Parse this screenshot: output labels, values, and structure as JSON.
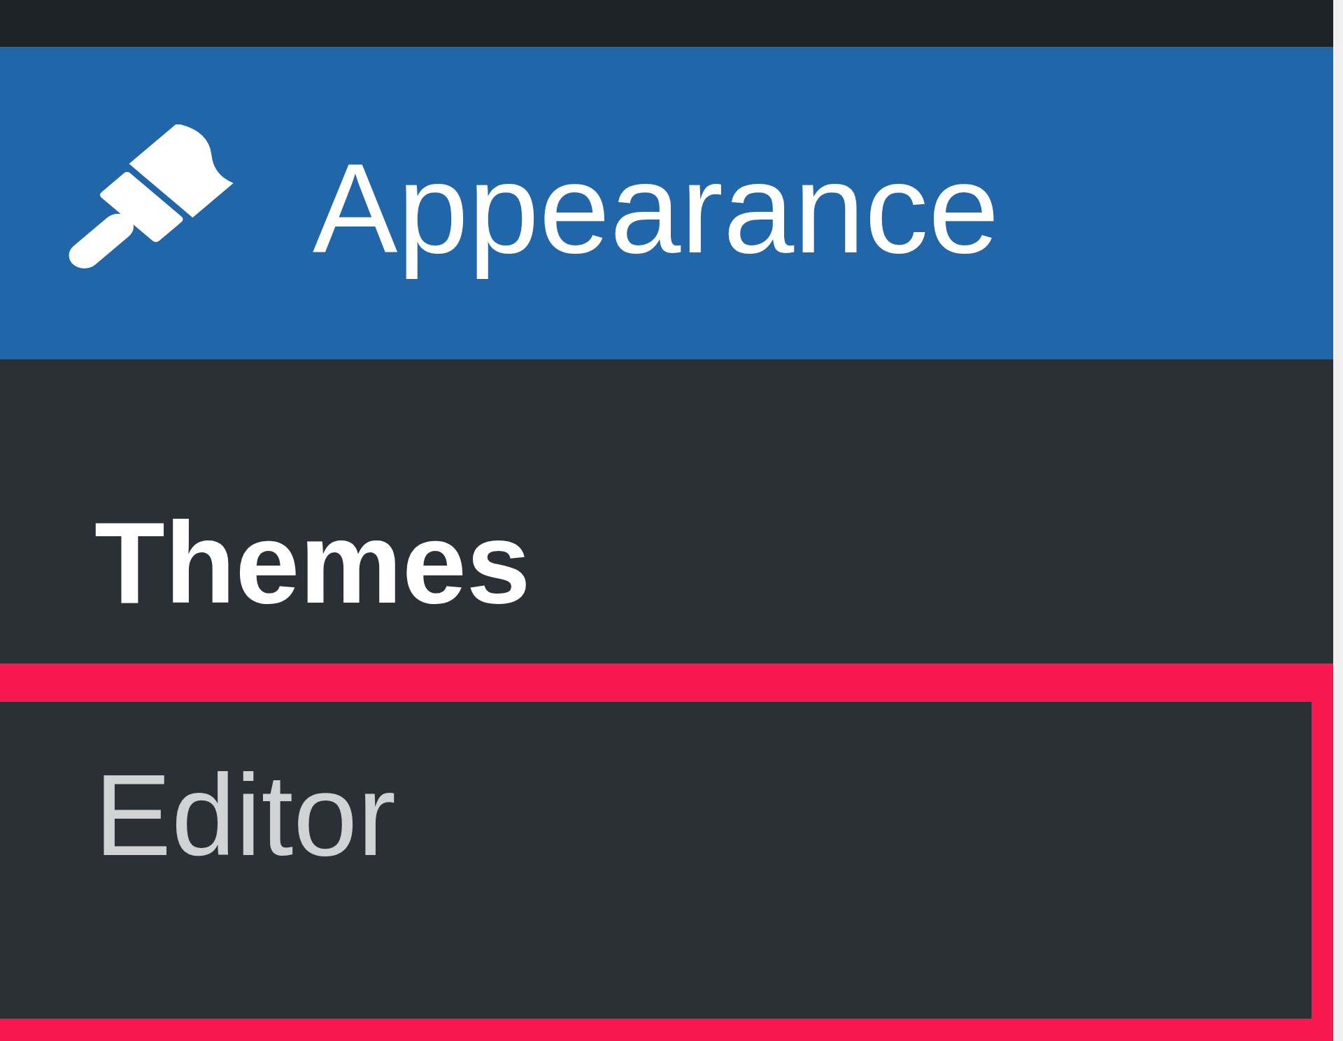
{
  "sidebar": {
    "items": [
      {
        "label": "Appearance",
        "selected": true,
        "expanded": true,
        "children": [
          {
            "label": "Themes",
            "selected": true,
            "highlighted": false
          },
          {
            "label": "Editor",
            "selected": false,
            "highlighted": true
          }
        ]
      }
    ]
  }
}
